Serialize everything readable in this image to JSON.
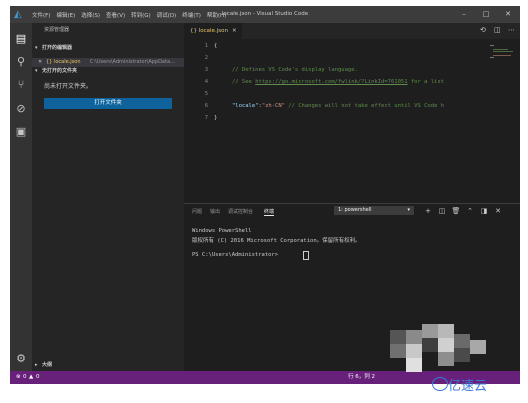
{
  "window": {
    "title": "locale.json - Visual Studio Code",
    "menu": [
      "文件(F)",
      "编辑(E)",
      "选择(S)",
      "查看(V)",
      "转到(G)",
      "调试(D)",
      "终端(T)",
      "帮助(H)"
    ]
  },
  "activity_bar": {
    "icons": [
      "files-icon",
      "search-icon",
      "source-control-icon",
      "debug-icon",
      "extensions-icon",
      "settings-gear-icon"
    ]
  },
  "sidebar": {
    "title": "资源管理器",
    "open_editors_label": "打开的编辑器",
    "open_editor_item": "{} locale.json",
    "open_editor_path": "C:\\Users\\Administrator\\AppData...",
    "no_folder_label": "无打开的文件夹",
    "no_folder_message": "尚未打开文件夹。",
    "open_folder_button": "打开文件夹",
    "outline_label": "大纲"
  },
  "editor": {
    "tab_label": "{} locale.json",
    "lines": [
      {
        "n": "1",
        "text": "{"
      },
      {
        "n": "2",
        "text": ""
      },
      {
        "n": "3",
        "text": "// Defines VS Code's display language."
      },
      {
        "n": "4",
        "prefix": "// See ",
        "link": "https://go.microsoft.com/fwlink/?LinkId=761051",
        "suffix": " for a list"
      },
      {
        "n": "5",
        "text": ""
      },
      {
        "n": "6",
        "key": "\"locale\"",
        "colon": ":",
        "value": "\"zh-CN\"",
        "comment": " // Changes will not take effect until VS Code h"
      },
      {
        "n": "7",
        "text": "}"
      }
    ]
  },
  "panel": {
    "tabs": [
      "问题",
      "输出",
      "调试控制台",
      "终端"
    ],
    "terminal_select": "1: powershell",
    "terminal_lines": [
      "Windows PowerShell",
      "版权所有 (C) 2016 Microsoft Corporation。保留所有权利。",
      "",
      "PS C:\\Users\\Administrator>"
    ]
  },
  "status_bar": {
    "errors": "0",
    "warnings": "0",
    "position": "行 6，列 2"
  },
  "watermark": {
    "text": "亿速云"
  },
  "colors": {
    "accent_blue": "#0e639c",
    "status_purple": "#68217a",
    "watermark_blue": "#3b78d8"
  }
}
